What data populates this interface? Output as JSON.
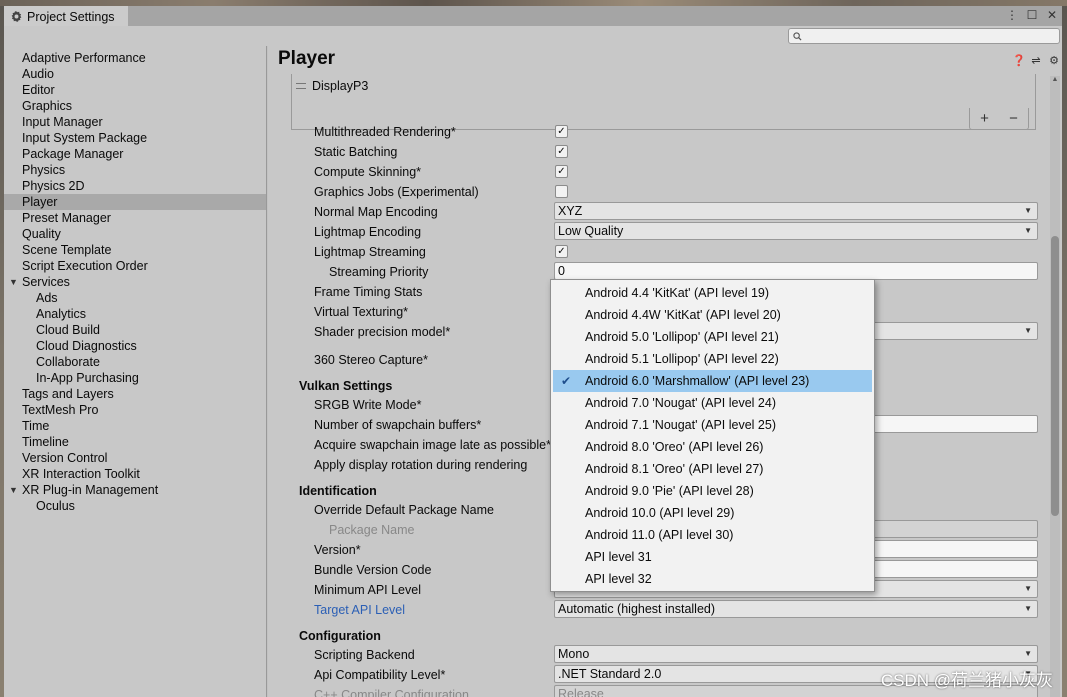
{
  "window": {
    "tab_title": "Project Settings",
    "controls": {
      "menu": "⋮",
      "maximize": "☐",
      "close": "✕"
    }
  },
  "search": {
    "placeholder": ""
  },
  "sidebar": {
    "items": [
      {
        "label": "Adaptive Performance"
      },
      {
        "label": "Audio"
      },
      {
        "label": "Editor"
      },
      {
        "label": "Graphics"
      },
      {
        "label": "Input Manager"
      },
      {
        "label": "Input System Package"
      },
      {
        "label": "Package Manager"
      },
      {
        "label": "Physics"
      },
      {
        "label": "Physics 2D"
      },
      {
        "label": "Player",
        "selected": true
      },
      {
        "label": "Preset Manager"
      },
      {
        "label": "Quality"
      },
      {
        "label": "Scene Template"
      },
      {
        "label": "Script Execution Order"
      },
      {
        "label": "Services",
        "expandable": true
      },
      {
        "label": "Ads",
        "sub": true
      },
      {
        "label": "Analytics",
        "sub": true
      },
      {
        "label": "Cloud Build",
        "sub": true
      },
      {
        "label": "Cloud Diagnostics",
        "sub": true
      },
      {
        "label": "Collaborate",
        "sub": true
      },
      {
        "label": "In-App Purchasing",
        "sub": true
      },
      {
        "label": "Tags and Layers"
      },
      {
        "label": "TextMesh Pro"
      },
      {
        "label": "Time"
      },
      {
        "label": "Timeline"
      },
      {
        "label": "Version Control"
      },
      {
        "label": "XR Interaction Toolkit"
      },
      {
        "label": "XR Plug-in Management",
        "expandable": true
      },
      {
        "label": "Oculus",
        "sub": true
      }
    ]
  },
  "main": {
    "title": "Player",
    "color_gamut_item": "DisplayP3",
    "list_add": "+",
    "list_remove": "−",
    "settings": {
      "multithreaded_rendering": "Multithreaded Rendering*",
      "static_batching": "Static Batching",
      "compute_skinning": "Compute Skinning*",
      "graphics_jobs": "Graphics Jobs (Experimental)",
      "normal_map_encoding": "Normal Map Encoding",
      "normal_map_encoding_value": "XYZ",
      "lightmap_encoding": "Lightmap Encoding",
      "lightmap_encoding_value": "Low Quality",
      "lightmap_streaming": "Lightmap Streaming",
      "streaming_priority": "Streaming Priority",
      "streaming_priority_value": "0",
      "frame_timing_stats": "Frame Timing Stats",
      "virtual_texturing": "Virtual Texturing*",
      "shader_precision_model": "Shader precision model*",
      "stereo_capture": "360 Stereo Capture*",
      "vulkan_settings": "Vulkan Settings",
      "srgb_write_mode": "SRGB Write Mode*",
      "swapchain_buffers": "Number of swapchain buffers*",
      "acquire_swapchain": "Acquire swapchain image late as possible*",
      "display_rotation": "Apply display rotation during rendering",
      "identification": "Identification",
      "override_package_name": "Override Default Package Name",
      "package_name": "Package Name",
      "version": "Version*",
      "bundle_version_code": "Bundle Version Code",
      "minimum_api_level": "Minimum API Level",
      "target_api_level": "Target API Level",
      "target_api_level_value": "Automatic (highest installed)",
      "configuration": "Configuration",
      "scripting_backend": "Scripting Backend",
      "scripting_backend_value": "Mono",
      "api_compatibility": "Api Compatibility Level*",
      "api_compatibility_value": ".NET Standard 2.0",
      "cpp_compiler": "C++ Compiler Configuration",
      "cpp_compiler_value": "Release"
    },
    "checks": {
      "multithreaded_rendering": true,
      "static_batching": true,
      "compute_skinning": true,
      "graphics_jobs": false,
      "lightmap_streaming": true
    }
  },
  "api_popup": {
    "options": [
      "Android 4.4 'KitKat' (API level 19)",
      "Android 4.4W 'KitKat' (API level 20)",
      "Android 5.0 'Lollipop' (API level 21)",
      "Android 5.1 'Lollipop' (API level 22)",
      "Android 6.0 'Marshmallow' (API level 23)",
      "Android 7.0 'Nougat' (API level 24)",
      "Android 7.1 'Nougat' (API level 25)",
      "Android 8.0 'Oreo' (API level 26)",
      "Android 8.1 'Oreo' (API level 27)",
      "Android 9.0 'Pie' (API level 28)",
      "Android 10.0 (API level 29)",
      "Android 11.0 (API level 30)",
      "API level 31",
      "API level 32"
    ],
    "selected": "Android 6.0 'Marshmallow' (API level 23)"
  },
  "watermark": "CSDN @荷兰猪小灰灰",
  "colors": {
    "selection": "#99c9ef",
    "link": "#2b5fb5",
    "sidebar_selected": "#a9a9a9"
  }
}
